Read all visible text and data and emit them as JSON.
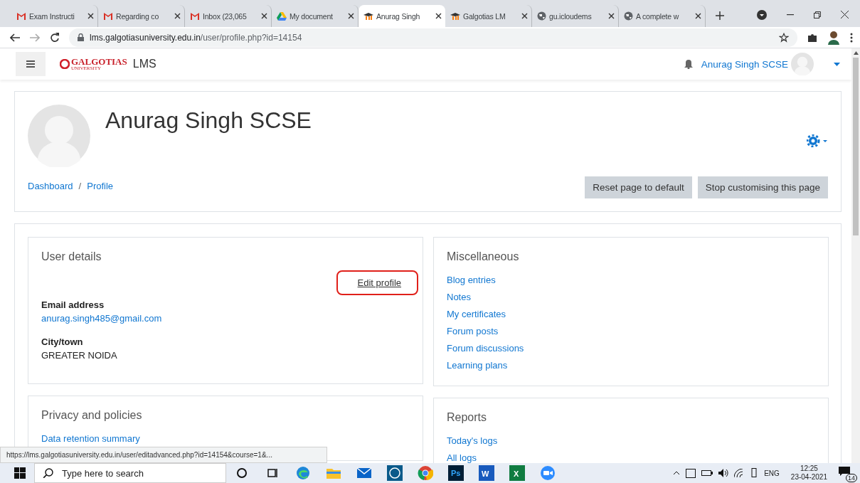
{
  "browser": {
    "tabs": [
      {
        "title": "Exam Instructi",
        "kind": "gmail",
        "selected": false
      },
      {
        "title": "Regarding co",
        "kind": "gmail",
        "selected": false
      },
      {
        "title": "Inbox (23,065",
        "kind": "gmail",
        "selected": false
      },
      {
        "title": "My document",
        "kind": "drive",
        "selected": false
      },
      {
        "title": "Anurag Singh",
        "kind": "moodle",
        "selected": true
      },
      {
        "title": "Galgotias LM",
        "kind": "moodle",
        "selected": false
      },
      {
        "title": "gu.icloudems",
        "kind": "globe",
        "selected": false
      },
      {
        "title": "A complete w",
        "kind": "globe",
        "selected": false
      }
    ],
    "address": {
      "host": "lms.galgotiasuniversity.edu.in",
      "path": "/user/profile.php?id=14154"
    }
  },
  "navbar": {
    "logo": "GALGOTIAS",
    "logo_sub": "UNIVERSITY",
    "brand": "LMS",
    "user": "Anurag Singh SCSE"
  },
  "header": {
    "name": "Anurag Singh SCSE",
    "breadcrumbs": [
      "Dashboard",
      "Profile"
    ],
    "breadcrumb_separator": "/",
    "buttons": [
      "Reset page to default",
      "Stop customising this page"
    ]
  },
  "user_details": {
    "title": "User details",
    "edit_link": {
      "label": "Edit profile",
      "highlighted": true
    },
    "fields": [
      {
        "label": "Email address",
        "value": "anurag.singh485@gmail.com",
        "kind": "link"
      },
      {
        "label": "City/town",
        "value": "GREATER NOIDA",
        "kind": "text"
      }
    ]
  },
  "privacy": {
    "title": "Privacy and policies",
    "links": [
      "Data retention summary"
    ]
  },
  "miscellaneous": {
    "title": "Miscellaneous",
    "links": [
      "Blog entries",
      "Notes",
      "My certificates",
      "Forum posts",
      "Forum discussions",
      "Learning plans"
    ]
  },
  "reports": {
    "title": "Reports",
    "links": [
      "Today's logs",
      "All logs"
    ]
  },
  "status_url": "https://lms.galgotiasuniversity.edu.in/user/editadvanced.php?id=14154&course=1&...",
  "taskbar": {
    "search_placeholder": "Type here to search",
    "apps": [
      {
        "kind": "cortana"
      },
      {
        "kind": "taskview"
      },
      {
        "kind": "edge"
      },
      {
        "kind": "explorer"
      },
      {
        "kind": "mail"
      },
      {
        "kind": "dell"
      },
      {
        "kind": "chrome"
      },
      {
        "kind": "photoshop",
        "label": "Ps"
      },
      {
        "kind": "word",
        "label": "W"
      },
      {
        "kind": "excel",
        "label": "X"
      },
      {
        "kind": "zoom"
      }
    ],
    "language": "ENG",
    "time": "12:25",
    "date": "23-04-2021",
    "notifications": "14"
  }
}
